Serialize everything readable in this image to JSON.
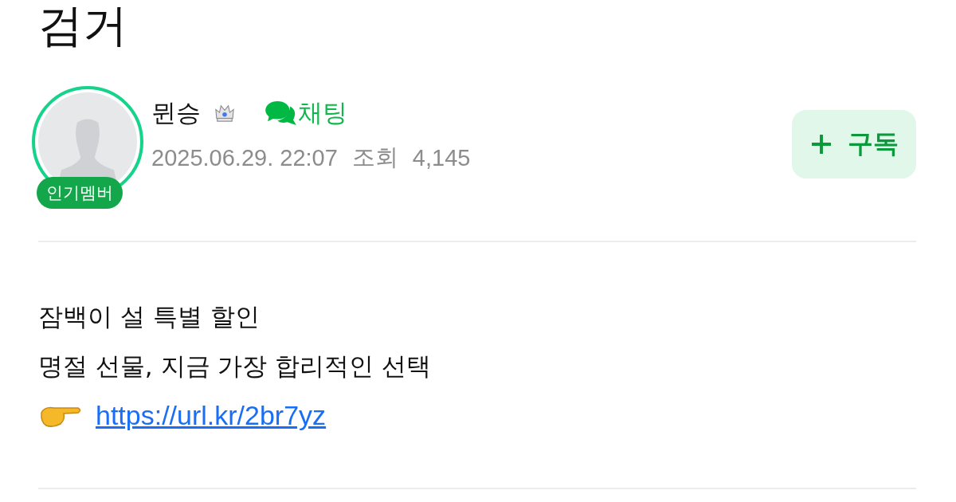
{
  "title": "검거",
  "author": {
    "name": "뮌승",
    "badge": "인기멤버",
    "chat_label": "채팅",
    "date": "2025.06.29. 22:07",
    "views_label": "조회",
    "views": "4,145"
  },
  "subscribe_button": {
    "label": "구독"
  },
  "body": [
    {
      "kind": "text",
      "text": "잠백이 설 특별 할인"
    },
    {
      "kind": "text",
      "text": "명절 선물, 지금 가장 합리적인 선택"
    },
    {
      "kind": "link",
      "text": "https://url.kr/2br7yz"
    }
  ]
}
